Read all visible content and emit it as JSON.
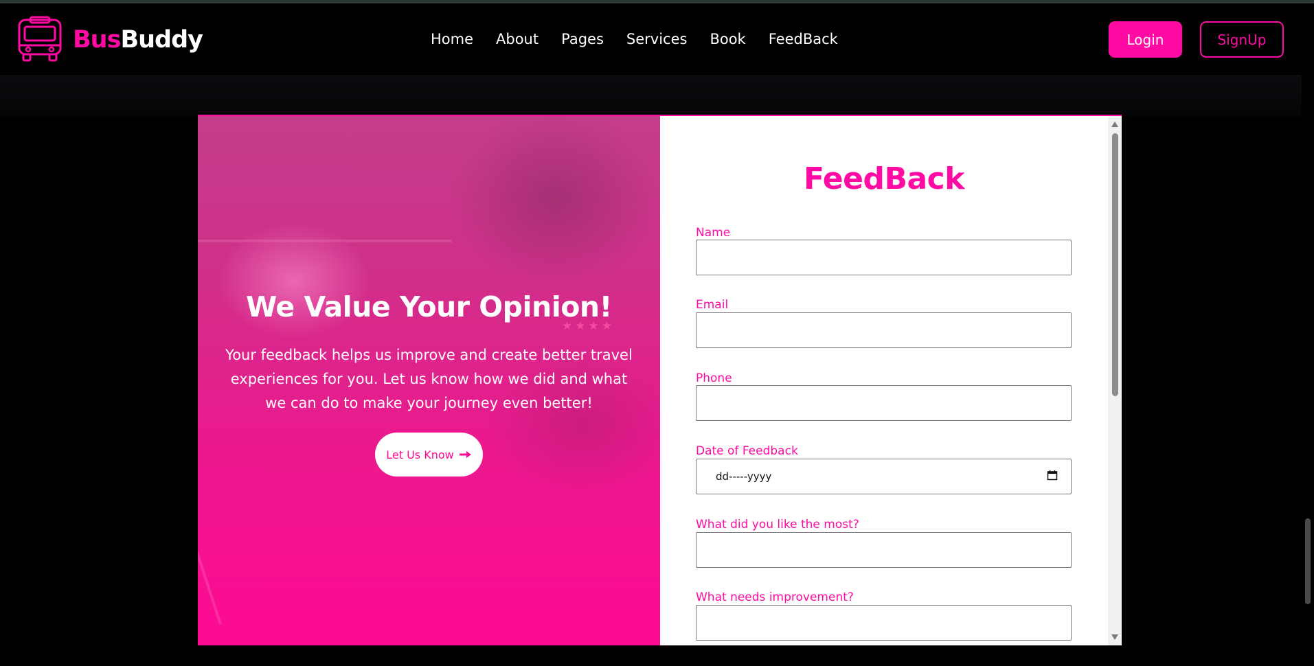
{
  "brand": {
    "part1": "Bus",
    "part2": "Buddy",
    "accent_color": "#ff0aa3",
    "logo_icon": "bus-icon"
  },
  "nav": {
    "links": [
      "Home",
      "About",
      "Pages",
      "Services",
      "Book",
      "FeedBack"
    ]
  },
  "auth": {
    "login": "Login",
    "signup": "SignUp"
  },
  "hero": {
    "title": "We Value Your Opinion!",
    "text": "Your feedback helps us improve and create better travel experiences for you. Let us know how we did and what we can do to make your journey even better!",
    "button_label": "Let Us Know",
    "button_icon": "arrow-right-icon"
  },
  "form": {
    "title": "FeedBack",
    "fields": {
      "name": {
        "label": "Name",
        "value": ""
      },
      "email": {
        "label": "Email",
        "value": ""
      },
      "phone": {
        "label": "Phone",
        "value": ""
      },
      "date": {
        "label": "Date of Feedback",
        "value": "dd-----yyyy"
      },
      "liked": {
        "label": "What did you like the most?",
        "value": ""
      },
      "improve": {
        "label": "What needs improvement?",
        "value": ""
      }
    }
  }
}
